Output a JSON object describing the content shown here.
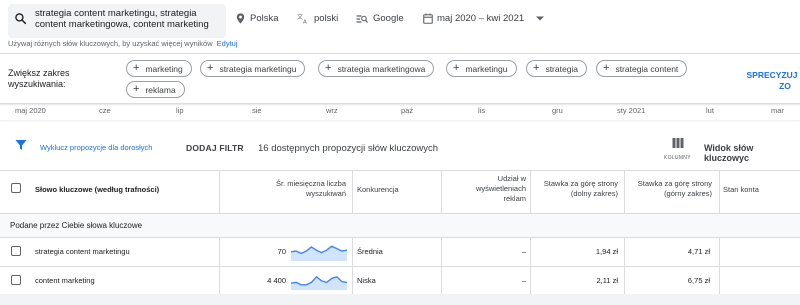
{
  "search": {
    "keywords_text": "strategia content marketingu, strategia content marketingowa, content marketing",
    "hint": "Używaj różnych słów kluczowych, by uzyskać więcej wyników",
    "edit_link": "Edytuj"
  },
  "filters": {
    "location": "Polska",
    "language": "polski",
    "network": "Google",
    "date_range": "maj 2020 – kwi 2021"
  },
  "broaden": {
    "label": "Zwiększ zakres wyszukiwania:",
    "chips": [
      "marketing",
      "strategia marketingu",
      "strategia marketingowa",
      "marketingu",
      "strategia",
      "strategia content",
      "reklama"
    ],
    "refine_label": "SPRECYZUJ KLUCZO"
  },
  "months": [
    "maj 2020",
    "cze",
    "lip",
    "sie",
    "wrz",
    "paź",
    "lis",
    "gru",
    "sty 2021",
    "lut",
    "mar"
  ],
  "toolbar": {
    "exclude_adult": "Wyklucz propozycje dla dorosłych",
    "add_filter": "DODAJ FILTR",
    "available_count": "16 dostępnych propozycji słów kluczowych",
    "columns_label": "KOLUMNY",
    "view_label": "Widok słów kluczowyc"
  },
  "table": {
    "headers": {
      "keyword": "Słowo kluczowe (według trafności)",
      "avg_searches": "Śr. miesięczna liczba wyszukiwań",
      "competition": "Konkurencja",
      "impression_share": "Udział w wyświetleniach reklam",
      "bid_low": "Stawka za górę strony (dolny zakres)",
      "bid_high": "Stawka za górę strony (górny zakres)",
      "account_status": "Stan konta"
    },
    "group_label": "Podane przez Ciebie słowa kluczowe",
    "rows": [
      {
        "keyword": "strategia content marketingu",
        "avg_searches": "70",
        "trend": [
          0.45,
          0.5,
          0.35,
          0.5,
          0.75,
          0.55,
          0.4,
          0.55,
          0.8,
          0.65,
          0.5,
          0.55
        ],
        "competition": "Średnia",
        "impression_share": "–",
        "bid_low": "1,94 zł",
        "bid_high": "4,71 zł",
        "account_status": ""
      },
      {
        "keyword": "content marketing",
        "avg_searches": "4 400",
        "trend": [
          0.3,
          0.35,
          0.2,
          0.2,
          0.35,
          0.7,
          0.45,
          0.35,
          0.6,
          0.7,
          0.4,
          0.35
        ],
        "competition": "Niska",
        "impression_share": "–",
        "bid_low": "2,11 zł",
        "bid_high": "6,75 zł",
        "account_status": ""
      }
    ]
  },
  "colors": {
    "accent": "#1a73e8",
    "sparkline": "#4285f4",
    "sparkline_fill": "#d2e3fc"
  }
}
